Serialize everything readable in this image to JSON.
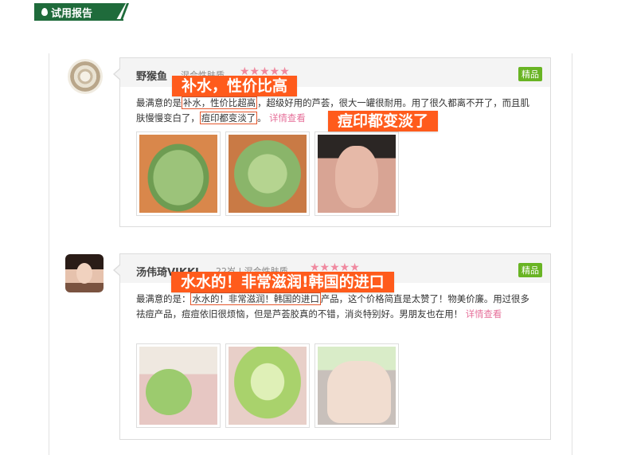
{
  "header": {
    "title": "试用报告"
  },
  "reviews": [
    {
      "username": "野猴鱼",
      "meta": "混合性肤质",
      "stars": "★★★★★",
      "badge": "精品",
      "text": {
        "prefix": "最满意的是",
        "hl1": "补水，性价比超高",
        "mid": "，超级好用的芦荟，很大一罐很耐用。用了很久都离不开了，而且肌肤慢慢变白了，",
        "hl2": "痘印都变淡了",
        "end": "。",
        "more": "详情查看"
      },
      "callouts": [
        "补水，性价比高",
        "痘印都变淡了"
      ]
    },
    {
      "username": "汤伟琦VIKKI",
      "meta": "22岁 | 混合性肤质",
      "stars": "★★★★★",
      "badge": "精品",
      "text": {
        "prefix": "最满意的是：",
        "hl1": "水水的！非常滋润！韩国的进口",
        "mid": "产品，这个价格简直是太赞了！物美价廉。用过很多祛痘产品，痘痘依旧很烦恼，但是芦荟胶真的不错，消炎特别好。男朋友也在用！",
        "more": "详情查看"
      },
      "callouts": [
        "水水的！非常滋润!韩国的进口"
      ]
    }
  ]
}
